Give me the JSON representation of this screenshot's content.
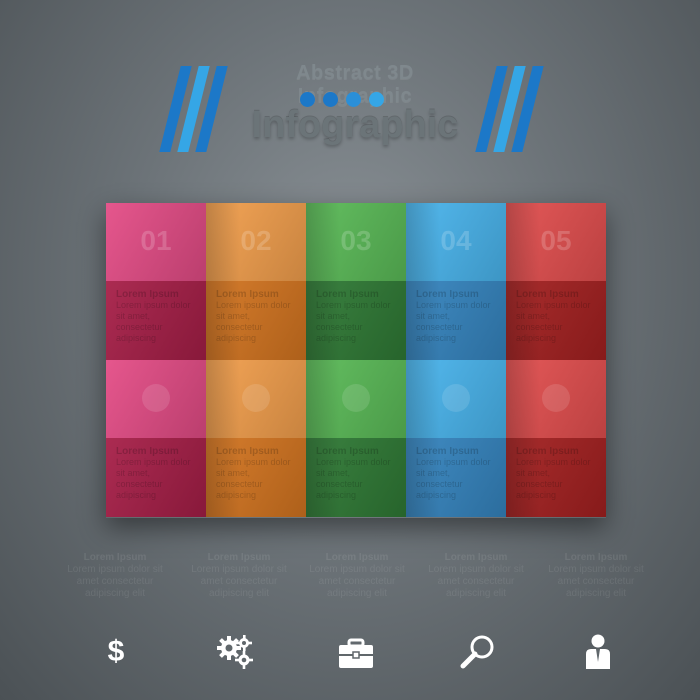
{
  "header": {
    "top_text": "Abstract 3D Infographic",
    "title": "Infographic"
  },
  "colors": {
    "stripe_dark": "#1c78c8",
    "stripe_light": "#35a6e6",
    "dots": [
      "#1c78c8",
      "#1c78c8",
      "#2a8fd8",
      "#35a6e6"
    ],
    "columns": [
      {
        "top": "#e44c86",
        "bottom": "#a61e47"
      },
      {
        "top": "#f4a04d",
        "bottom": "#d47520"
      },
      {
        "top": "#5bbc58",
        "bottom": "#2f7a35"
      },
      {
        "top": "#4ab6ef",
        "bottom": "#3585c0"
      },
      {
        "top": "#e44f4f",
        "bottom": "#a42020"
      }
    ]
  },
  "tiles": {
    "numbers": [
      "01",
      "02",
      "03",
      "04",
      "05"
    ],
    "text_heading": "Lorem Ipsum",
    "text_body": "Lorem ipsum dolor sit amet, consectetur adipiscing"
  },
  "columns_text": [
    {
      "heading": "Lorem Ipsum",
      "body": "Lorem ipsum dolor sit amet consectetur adipiscing elit"
    },
    {
      "heading": "Lorem Ipsum",
      "body": "Lorem ipsum dolor sit amet consectetur adipiscing elit"
    },
    {
      "heading": "Lorem Ipsum",
      "body": "Lorem ipsum dolor sit amet consectetur adipiscing elit"
    },
    {
      "heading": "Lorem Ipsum",
      "body": "Lorem ipsum dolor sit amet consectetur adipiscing elit"
    },
    {
      "heading": "Lorem Ipsum",
      "body": "Lorem ipsum dolor sit amet consectetur adipiscing elit"
    }
  ],
  "icons": {
    "dollar": "$",
    "names": [
      "dollar-icon",
      "gears-icon",
      "briefcase-icon",
      "magnifier-icon",
      "user-icon"
    ]
  }
}
